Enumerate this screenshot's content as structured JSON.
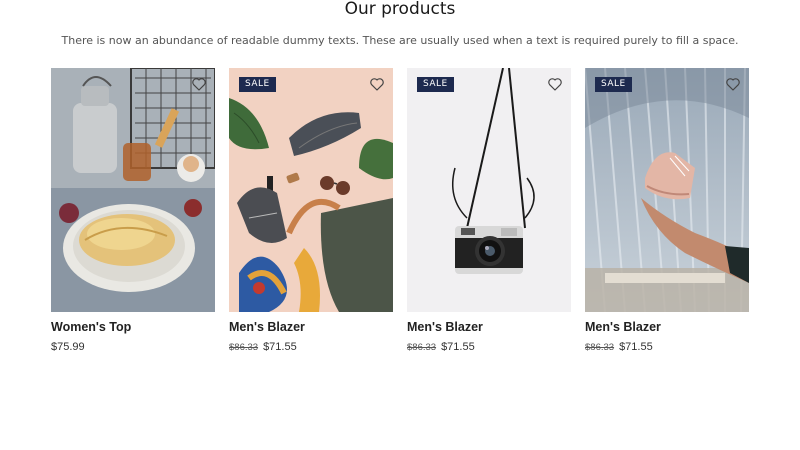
{
  "section": {
    "title": "Our products",
    "subtitle": "There is now an abundance of readable dummy texts. These are usually used when a text is required purely to fill a space."
  },
  "products": [
    {
      "name": "Women's Top",
      "price": "$75.99",
      "old_price": "",
      "badge": "",
      "image_icon": "pancakes-photo"
    },
    {
      "name": "Men's Blazer",
      "price": "$71.55",
      "old_price": "$86.33",
      "badge": "SALE",
      "image_icon": "flatlay-photo"
    },
    {
      "name": "Men's Blazer",
      "price": "$71.55",
      "old_price": "$86.33",
      "badge": "SALE",
      "image_icon": "camera-photo"
    },
    {
      "name": "Men's Blazer",
      "price": "$71.55",
      "old_price": "$86.33",
      "badge": "SALE",
      "image_icon": "shoe-photo"
    }
  ],
  "colors": {
    "badge_bg": "#1d2a4f",
    "text": "#222222"
  },
  "icons": {
    "wishlist": "heart-icon"
  }
}
